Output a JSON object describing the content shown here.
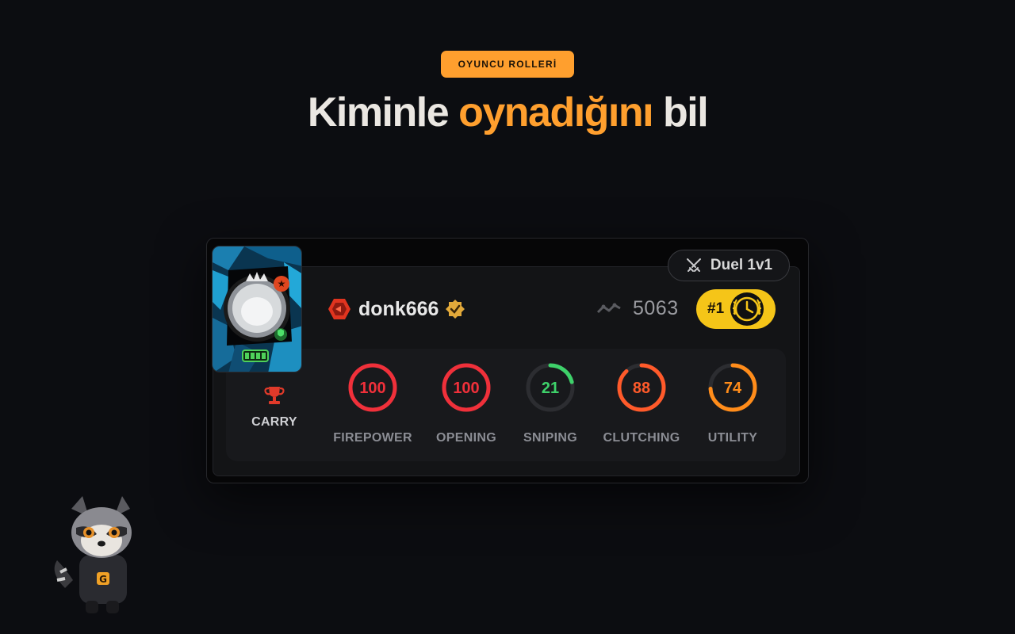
{
  "header": {
    "badge": "OYUNCU ROLLERİ",
    "title_part1": "Kiminle ",
    "title_accent": "oynadığını",
    "title_part2": " bil"
  },
  "card": {
    "mode_label": "Duel 1v1",
    "player_name": "donk666",
    "elo": "5063",
    "rank": "#1",
    "role": "CARRY",
    "stats": [
      {
        "label": "FIREPOWER",
        "value": "100",
        "percent": 100,
        "color": "#f0303a"
      },
      {
        "label": "OPENING",
        "value": "100",
        "percent": 100,
        "color": "#f0303a"
      },
      {
        "label": "SNIPING",
        "value": "21",
        "percent": 21,
        "color": "#3ed16a"
      },
      {
        "label": "CLUTCHING",
        "value": "88",
        "percent": 88,
        "color": "#ff5a2a"
      },
      {
        "label": "UTILITY",
        "value": "74",
        "percent": 74,
        "color": "#ff8c1a"
      }
    ]
  },
  "colors": {
    "accent": "#ff9f2e",
    "rank_gold": "#f5c518",
    "role_red": "#e03a2a"
  },
  "icons": {
    "duel": "crossed-swords-icon",
    "level": "hexagon-level-icon",
    "verified": "verified-badge-icon",
    "elo": "trend-line-icon",
    "rank": "laurel-clock-icon",
    "role": "trophy-icon"
  }
}
